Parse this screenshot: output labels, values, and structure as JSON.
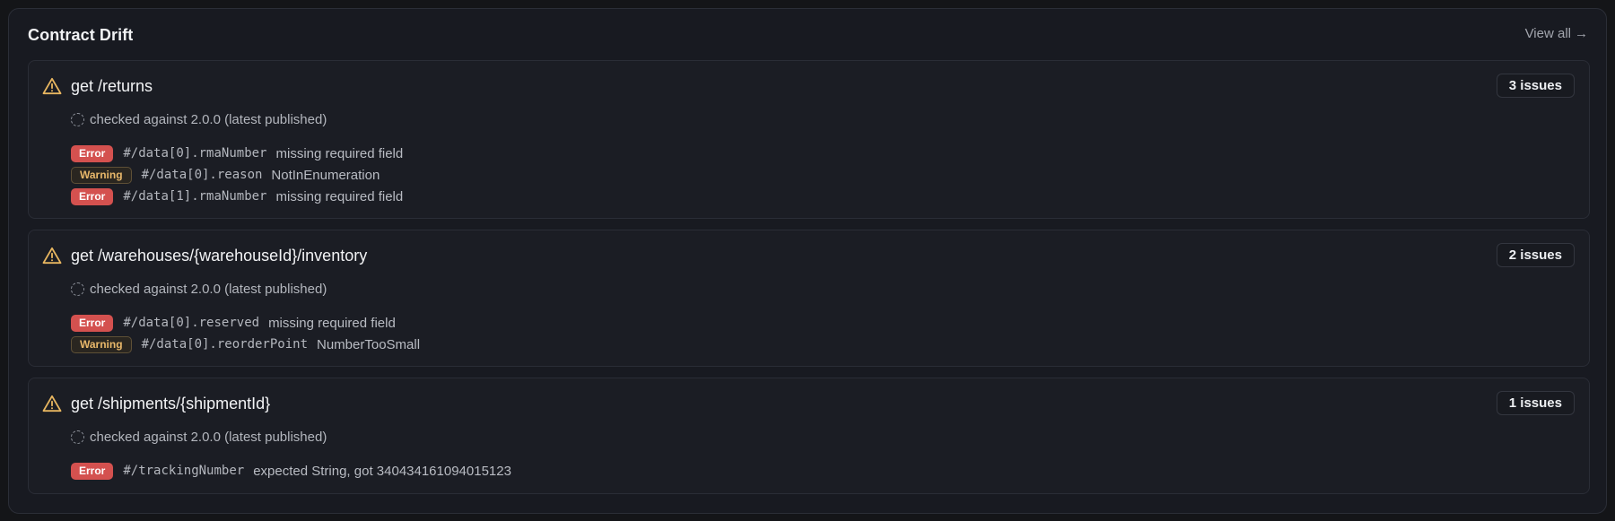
{
  "panel": {
    "title": "Contract Drift",
    "view_all_label": "View all",
    "view_all_arrow": "→"
  },
  "endpoints": [
    {
      "path": "get /returns",
      "issue_count": "3 issues",
      "checked_text": "checked against 2.0.0 (latest published)",
      "issues": [
        {
          "severity": "Error",
          "pointer": "#/data[0].rmaNumber",
          "message": "missing required field"
        },
        {
          "severity": "Warning",
          "pointer": "#/data[0].reason",
          "message": "NotInEnumeration"
        },
        {
          "severity": "Error",
          "pointer": "#/data[1].rmaNumber",
          "message": "missing required field"
        }
      ]
    },
    {
      "path": "get /warehouses/{warehouseId}/inventory",
      "issue_count": "2 issues",
      "checked_text": "checked against 2.0.0 (latest published)",
      "issues": [
        {
          "severity": "Error",
          "pointer": "#/data[0].reserved",
          "message": "missing required field"
        },
        {
          "severity": "Warning",
          "pointer": "#/data[0].reorderPoint",
          "message": "NumberTooSmall"
        }
      ]
    },
    {
      "path": "get /shipments/{shipmentId}",
      "issue_count": "1 issues",
      "checked_text": "checked against 2.0.0 (latest published)",
      "issues": [
        {
          "severity": "Error",
          "pointer": "#/trackingNumber",
          "message": "expected String, got 340434161094015123"
        }
      ]
    }
  ],
  "colors": {
    "error": "#d4514f",
    "warning": "#e9b86a",
    "warning_icon": "#e8b660"
  },
  "icons": {
    "endpoint": "warning-triangle-icon",
    "checked": "spinner-icon",
    "view_all": "arrow-right-icon"
  }
}
